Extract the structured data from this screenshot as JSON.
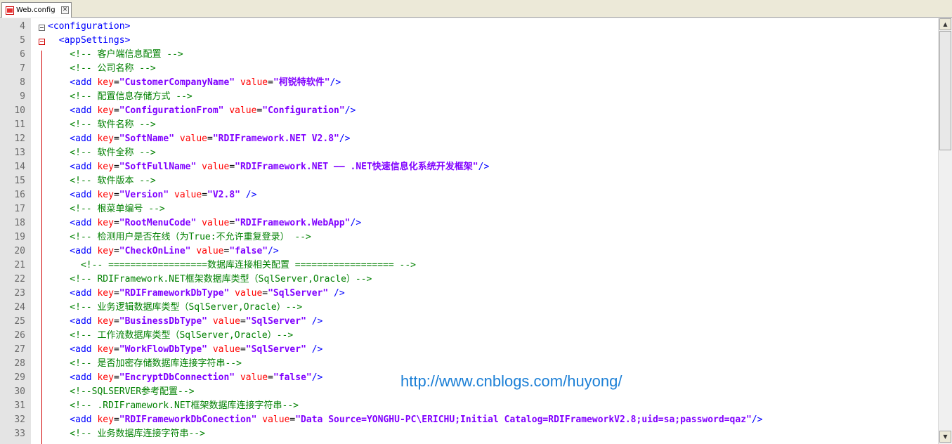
{
  "tab": {
    "label": "Web.config",
    "close": "✕"
  },
  "watermark": "http://www.cnblogs.com/huyong/",
  "lines": [
    {
      "n": "4",
      "parts": [
        [
          "tag",
          "<configuration>"
        ]
      ]
    },
    {
      "n": "5",
      "parts": [
        [
          "tag",
          "  <appSettings>"
        ]
      ]
    },
    {
      "n": "6",
      "parts": [
        [
          "cmt",
          "    <!-- 客户端信息配置 -->"
        ]
      ]
    },
    {
      "n": "7",
      "parts": [
        [
          "cmt",
          "    <!-- 公司名称 -->"
        ]
      ]
    },
    {
      "n": "8",
      "parts": [
        [
          "tag",
          "    <add "
        ],
        [
          "attr",
          "key"
        ],
        [
          "eq",
          "="
        ],
        [
          "val",
          "\"CustomerCompanyName\""
        ],
        [
          "tag",
          " "
        ],
        [
          "attr",
          "value"
        ],
        [
          "eq",
          "="
        ],
        [
          "val",
          "\"柯锐特软件\""
        ],
        [
          "tag",
          "/>"
        ]
      ]
    },
    {
      "n": "9",
      "parts": [
        [
          "cmt",
          "    <!-- 配置信息存储方式 -->"
        ]
      ]
    },
    {
      "n": "10",
      "parts": [
        [
          "tag",
          "    <add "
        ],
        [
          "attr",
          "key"
        ],
        [
          "eq",
          "="
        ],
        [
          "val",
          "\"ConfigurationFrom\""
        ],
        [
          "tag",
          " "
        ],
        [
          "attr",
          "value"
        ],
        [
          "eq",
          "="
        ],
        [
          "val",
          "\"Configuration\""
        ],
        [
          "tag",
          "/>"
        ]
      ]
    },
    {
      "n": "11",
      "parts": [
        [
          "cmt",
          "    <!-- 软件名称 -->"
        ]
      ]
    },
    {
      "n": "12",
      "parts": [
        [
          "tag",
          "    <add "
        ],
        [
          "attr",
          "key"
        ],
        [
          "eq",
          "="
        ],
        [
          "val",
          "\"SoftName\""
        ],
        [
          "tag",
          " "
        ],
        [
          "attr",
          "value"
        ],
        [
          "eq",
          "="
        ],
        [
          "val",
          "\"RDIFramework.NET V2.8\""
        ],
        [
          "tag",
          "/>"
        ]
      ]
    },
    {
      "n": "13",
      "parts": [
        [
          "cmt",
          "    <!-- 软件全称 -->"
        ]
      ]
    },
    {
      "n": "14",
      "parts": [
        [
          "tag",
          "    <add "
        ],
        [
          "attr",
          "key"
        ],
        [
          "eq",
          "="
        ],
        [
          "val",
          "\"SoftFullName\""
        ],
        [
          "tag",
          " "
        ],
        [
          "attr",
          "value"
        ],
        [
          "eq",
          "="
        ],
        [
          "val",
          "\"RDIFramework.NET —— .NET快速信息化系统开发框架\""
        ],
        [
          "tag",
          "/>"
        ]
      ]
    },
    {
      "n": "15",
      "parts": [
        [
          "cmt",
          "    <!-- 软件版本 -->"
        ]
      ]
    },
    {
      "n": "16",
      "parts": [
        [
          "tag",
          "    <add "
        ],
        [
          "attr",
          "key"
        ],
        [
          "eq",
          "="
        ],
        [
          "val",
          "\"Version\""
        ],
        [
          "tag",
          " "
        ],
        [
          "attr",
          "value"
        ],
        [
          "eq",
          "="
        ],
        [
          "val",
          "\"V2.8\""
        ],
        [
          "tag",
          " />"
        ]
      ]
    },
    {
      "n": "17",
      "parts": [
        [
          "cmt",
          "    <!-- 根菜单编号 -->"
        ]
      ]
    },
    {
      "n": "18",
      "parts": [
        [
          "tag",
          "    <add "
        ],
        [
          "attr",
          "key"
        ],
        [
          "eq",
          "="
        ],
        [
          "val",
          "\"RootMenuCode\""
        ],
        [
          "tag",
          " "
        ],
        [
          "attr",
          "value"
        ],
        [
          "eq",
          "="
        ],
        [
          "val",
          "\"RDIFramework.WebApp\""
        ],
        [
          "tag",
          "/>"
        ]
      ]
    },
    {
      "n": "19",
      "parts": [
        [
          "cmt",
          "    <!-- 检测用户是否在线（为True:不允许重复登录） -->"
        ]
      ]
    },
    {
      "n": "20",
      "parts": [
        [
          "tag",
          "    <add "
        ],
        [
          "attr",
          "key"
        ],
        [
          "eq",
          "="
        ],
        [
          "val",
          "\"CheckOnLine\""
        ],
        [
          "tag",
          " "
        ],
        [
          "attr",
          "value"
        ],
        [
          "eq",
          "="
        ],
        [
          "val",
          "\"false\""
        ],
        [
          "tag",
          "/>"
        ]
      ]
    },
    {
      "n": "21",
      "parts": [
        [
          "cmt",
          "      <!-- ==================数据库连接相关配置 ================== -->"
        ]
      ]
    },
    {
      "n": "22",
      "parts": [
        [
          "cmt",
          "    <!-- RDIFramework.NET框架数据库类型（SqlServer,Oracle）-->"
        ]
      ]
    },
    {
      "n": "23",
      "parts": [
        [
          "tag",
          "    <add "
        ],
        [
          "attr",
          "key"
        ],
        [
          "eq",
          "="
        ],
        [
          "val",
          "\"RDIFrameworkDbType\""
        ],
        [
          "tag",
          " "
        ],
        [
          "attr",
          "value"
        ],
        [
          "eq",
          "="
        ],
        [
          "val",
          "\"SqlServer\""
        ],
        [
          "tag",
          " />"
        ]
      ]
    },
    {
      "n": "24",
      "parts": [
        [
          "cmt",
          "    <!-- 业务逻辑数据库类型（SqlServer,Oracle）-->"
        ]
      ]
    },
    {
      "n": "25",
      "parts": [
        [
          "tag",
          "    <add "
        ],
        [
          "attr",
          "key"
        ],
        [
          "eq",
          "="
        ],
        [
          "val",
          "\"BusinessDbType\""
        ],
        [
          "tag",
          " "
        ],
        [
          "attr",
          "value"
        ],
        [
          "eq",
          "="
        ],
        [
          "val",
          "\"SqlServer\""
        ],
        [
          "tag",
          " />"
        ]
      ]
    },
    {
      "n": "26",
      "parts": [
        [
          "cmt",
          "    <!-- 工作流数据库类型（SqlServer,Oracle）-->"
        ]
      ]
    },
    {
      "n": "27",
      "parts": [
        [
          "tag",
          "    <add "
        ],
        [
          "attr",
          "key"
        ],
        [
          "eq",
          "="
        ],
        [
          "val",
          "\"WorkFlowDbType\""
        ],
        [
          "tag",
          " "
        ],
        [
          "attr",
          "value"
        ],
        [
          "eq",
          "="
        ],
        [
          "val",
          "\"SqlServer\""
        ],
        [
          "tag",
          " />"
        ]
      ]
    },
    {
      "n": "28",
      "parts": [
        [
          "cmt",
          "    <!-- 是否加密存储数据库连接字符串-->"
        ]
      ]
    },
    {
      "n": "29",
      "parts": [
        [
          "tag",
          "    <add "
        ],
        [
          "attr",
          "key"
        ],
        [
          "eq",
          "="
        ],
        [
          "val",
          "\"EncryptDbConnection\""
        ],
        [
          "tag",
          " "
        ],
        [
          "attr",
          "value"
        ],
        [
          "eq",
          "="
        ],
        [
          "val",
          "\"false\""
        ],
        [
          "tag",
          "/>"
        ]
      ]
    },
    {
      "n": "30",
      "parts": [
        [
          "cmt",
          "    <!--SQLSERVER参考配置-->"
        ]
      ]
    },
    {
      "n": "31",
      "parts": [
        [
          "cmt",
          "    <!-- .RDIFramework.NET框架数据库连接字符串-->"
        ]
      ]
    },
    {
      "n": "32",
      "parts": [
        [
          "tag",
          "    <add "
        ],
        [
          "attr",
          "key"
        ],
        [
          "eq",
          "="
        ],
        [
          "val",
          "\"RDIFrameworkDbConection\""
        ],
        [
          "tag",
          " "
        ],
        [
          "attr",
          "value"
        ],
        [
          "eq",
          "="
        ],
        [
          "val",
          "\"Data Source=YONGHU-PC\\ERICHU;Initial Catalog=RDIFrameworkV2.8;uid=sa;password=qaz\""
        ],
        [
          "tag",
          "/>"
        ]
      ]
    },
    {
      "n": "33",
      "parts": [
        [
          "cmt",
          "    <!-- 业务数据库连接字符串-->"
        ]
      ]
    }
  ],
  "scroll": {
    "up": "▲",
    "down": "▼"
  }
}
